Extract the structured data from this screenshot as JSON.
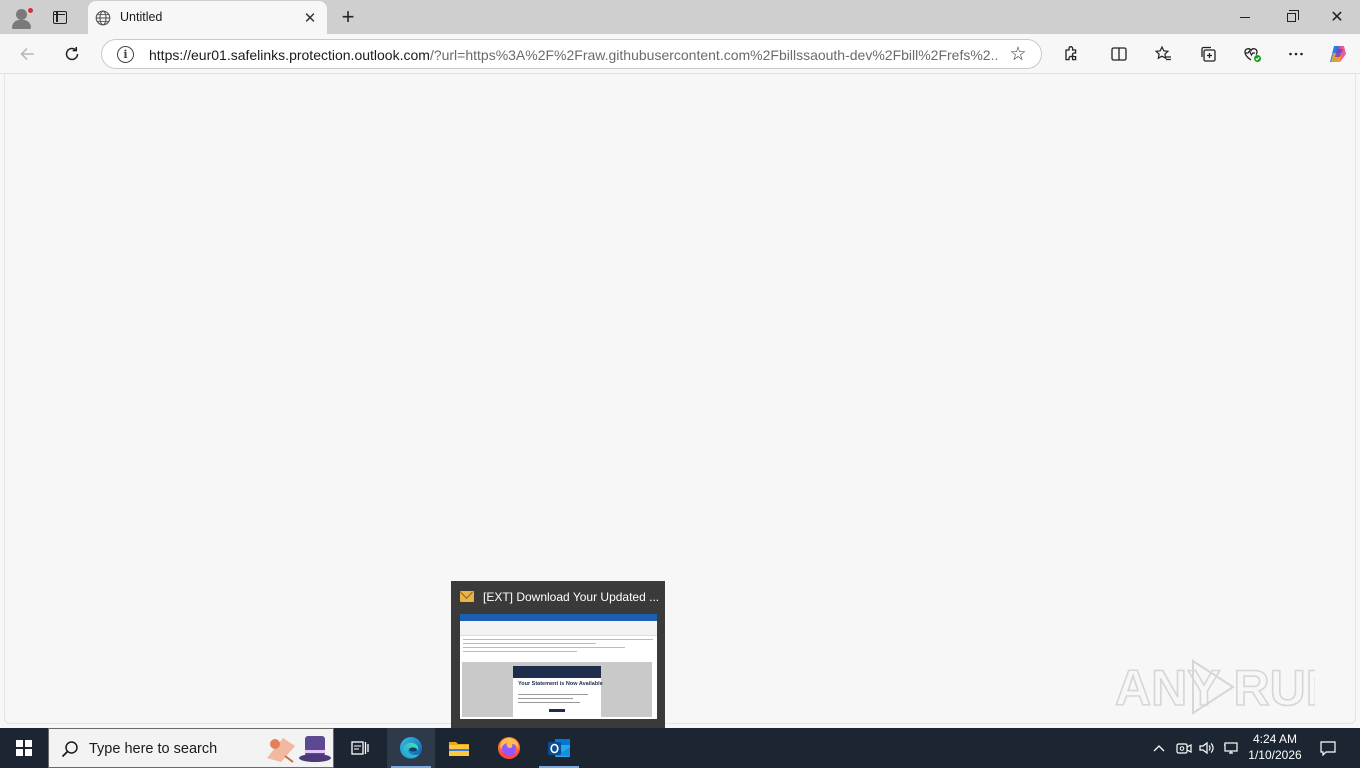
{
  "browser": {
    "tab": {
      "title": "Untitled",
      "close_glyph": "✕"
    },
    "new_tab_glyph": "+",
    "address": {
      "url_host": "https://eur01.safelinks.protection.outlook.com",
      "url_rest": "/?url=https%3A%2F%2Fraw.githubusercontent.com%2Fbillssaouth-dev%2Fbill%2Frefs%2..."
    },
    "toolbar_icons": [
      "extensions-icon",
      "split-screen-icon",
      "favorites-icon",
      "collections-icon",
      "browser-essentials-icon",
      "more-icon",
      "copilot-icon"
    ]
  },
  "watermark": {
    "text": "ANY RUN"
  },
  "taskbar_preview": {
    "title": "[EXT] Download Your Updated ...",
    "preview_heading": "Your Statement is Now Available"
  },
  "taskbar": {
    "search_placeholder": "Type here to search",
    "apps": [
      "task-view",
      "edge",
      "file-explorer",
      "firefox",
      "outlook"
    ],
    "clock": {
      "time": "4:24 AM",
      "date": "1/10/2026"
    }
  },
  "colors": {
    "tabstrip": "#cfcfcf",
    "taskbar": "#1c2633",
    "accent": "#1a5fb4"
  }
}
